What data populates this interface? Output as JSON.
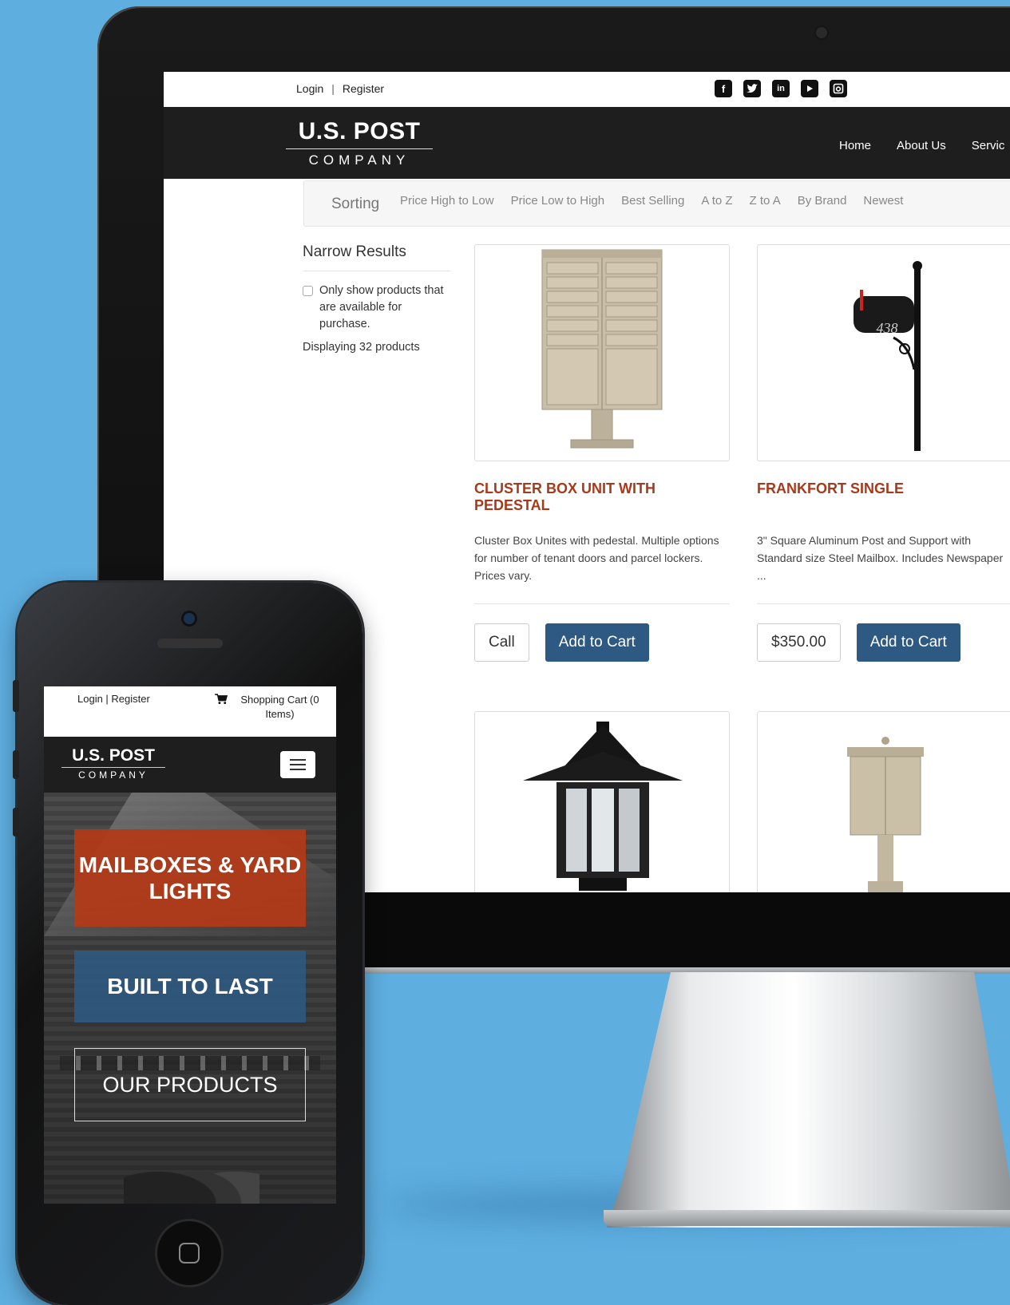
{
  "desktop": {
    "top_links": {
      "login": "Login",
      "separator": "|",
      "register": "Register"
    },
    "social_icons": [
      "facebook-icon",
      "twitter-icon",
      "linkedin-icon",
      "youtube-icon",
      "instagram-icon"
    ],
    "logo": {
      "line1": "U.S. POST",
      "line2": "COMPANY"
    },
    "nav": [
      "Home",
      "About Us",
      "Servic"
    ],
    "sorting": {
      "title": "Sorting",
      "options": [
        "Price High to Low",
        "Price Low to High",
        "Best Selling",
        "A to Z",
        "Z to A",
        "By Brand",
        "Newest"
      ]
    },
    "sidebar": {
      "title": "Narrow Results",
      "filter_label": "Only show products that are available for purchase.",
      "count_text": "Displaying 32 products"
    },
    "products": [
      {
        "title": "CLUSTER BOX UNIT WITH PEDESTAL",
        "description": "Cluster Box Unites with pedestal. Multiple options for number of tenant doors and parcel lockers. Prices vary.",
        "price_label": "Call",
        "cart_label": "Add to Cart"
      },
      {
        "title": "FRANKFORT SINGLE",
        "description": "3\" Square Aluminum Post and Support with Standard size Steel Mailbox. Includes Newspaper ...",
        "price_label": "$350.00",
        "cart_label": "Add to Cart",
        "house_number": "438"
      }
    ]
  },
  "mobile": {
    "top": {
      "login_register": "Login | Register",
      "cart": "Shopping Cart (0 Items)"
    },
    "logo": {
      "line1": "U.S. POST",
      "line2": "COMPANY"
    },
    "hero": {
      "banner1": "MAILBOXES & YARD LIGHTS",
      "banner2": "BUILT TO LAST",
      "banner3": "OUR PRODUCTS"
    }
  },
  "colors": {
    "background": "#5eaee0",
    "accent_red": "#a8391a",
    "button_blue": "#2e5982",
    "header_dark": "#1e1e1e"
  }
}
